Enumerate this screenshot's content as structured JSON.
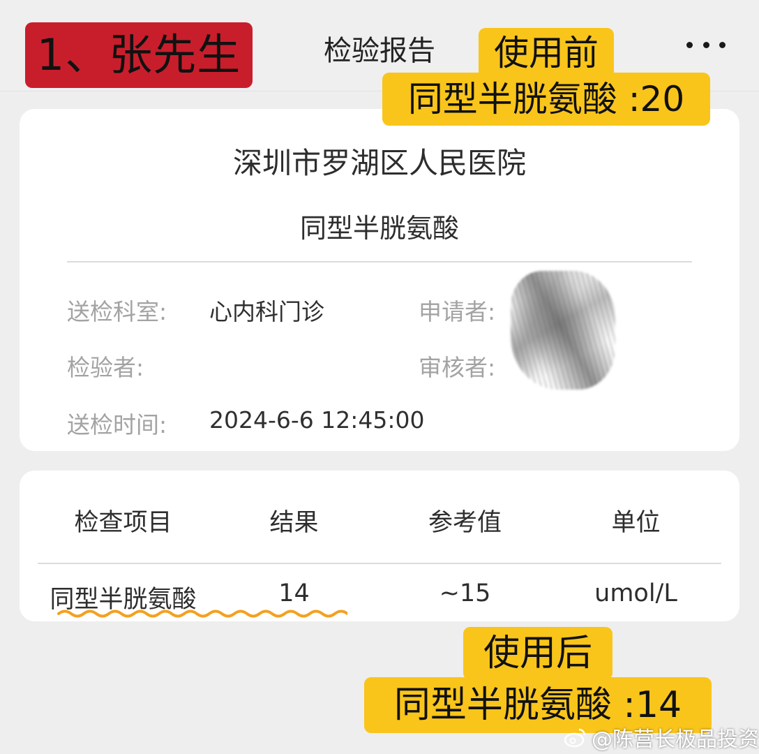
{
  "header": {
    "title": "检验报告",
    "more_icon": "more-horizontal-icon"
  },
  "overlays": {
    "patient_label": "1、张先生",
    "before_label": "使用前",
    "before_value": "同型半胱氨酸 :20",
    "after_label": "使用后",
    "after_value": "同型半胱氨酸 :14",
    "label_color": "#c81e2c",
    "highlight_color": "#f9c51b"
  },
  "report": {
    "hospital": "深圳市罗湖区人民医院",
    "test_name": "同型半胱氨酸",
    "fields": {
      "department_label": "送检科室:",
      "department_value": "心内科门诊",
      "applicant_label": "申请者:",
      "examiner_label": "检验者:",
      "reviewer_label": "审核者:",
      "time_label": "送检时间:",
      "time_value": "2024-6-6 12:45:00"
    }
  },
  "results_table": {
    "headers": [
      "检查项目",
      "结果",
      "参考值",
      "单位"
    ],
    "rows": [
      [
        "同型半胱氨酸",
        "14",
        "~15",
        "umol/L"
      ]
    ]
  },
  "watermark": {
    "text": "@陈营长极品投资",
    "icon": "weibo-icon"
  }
}
